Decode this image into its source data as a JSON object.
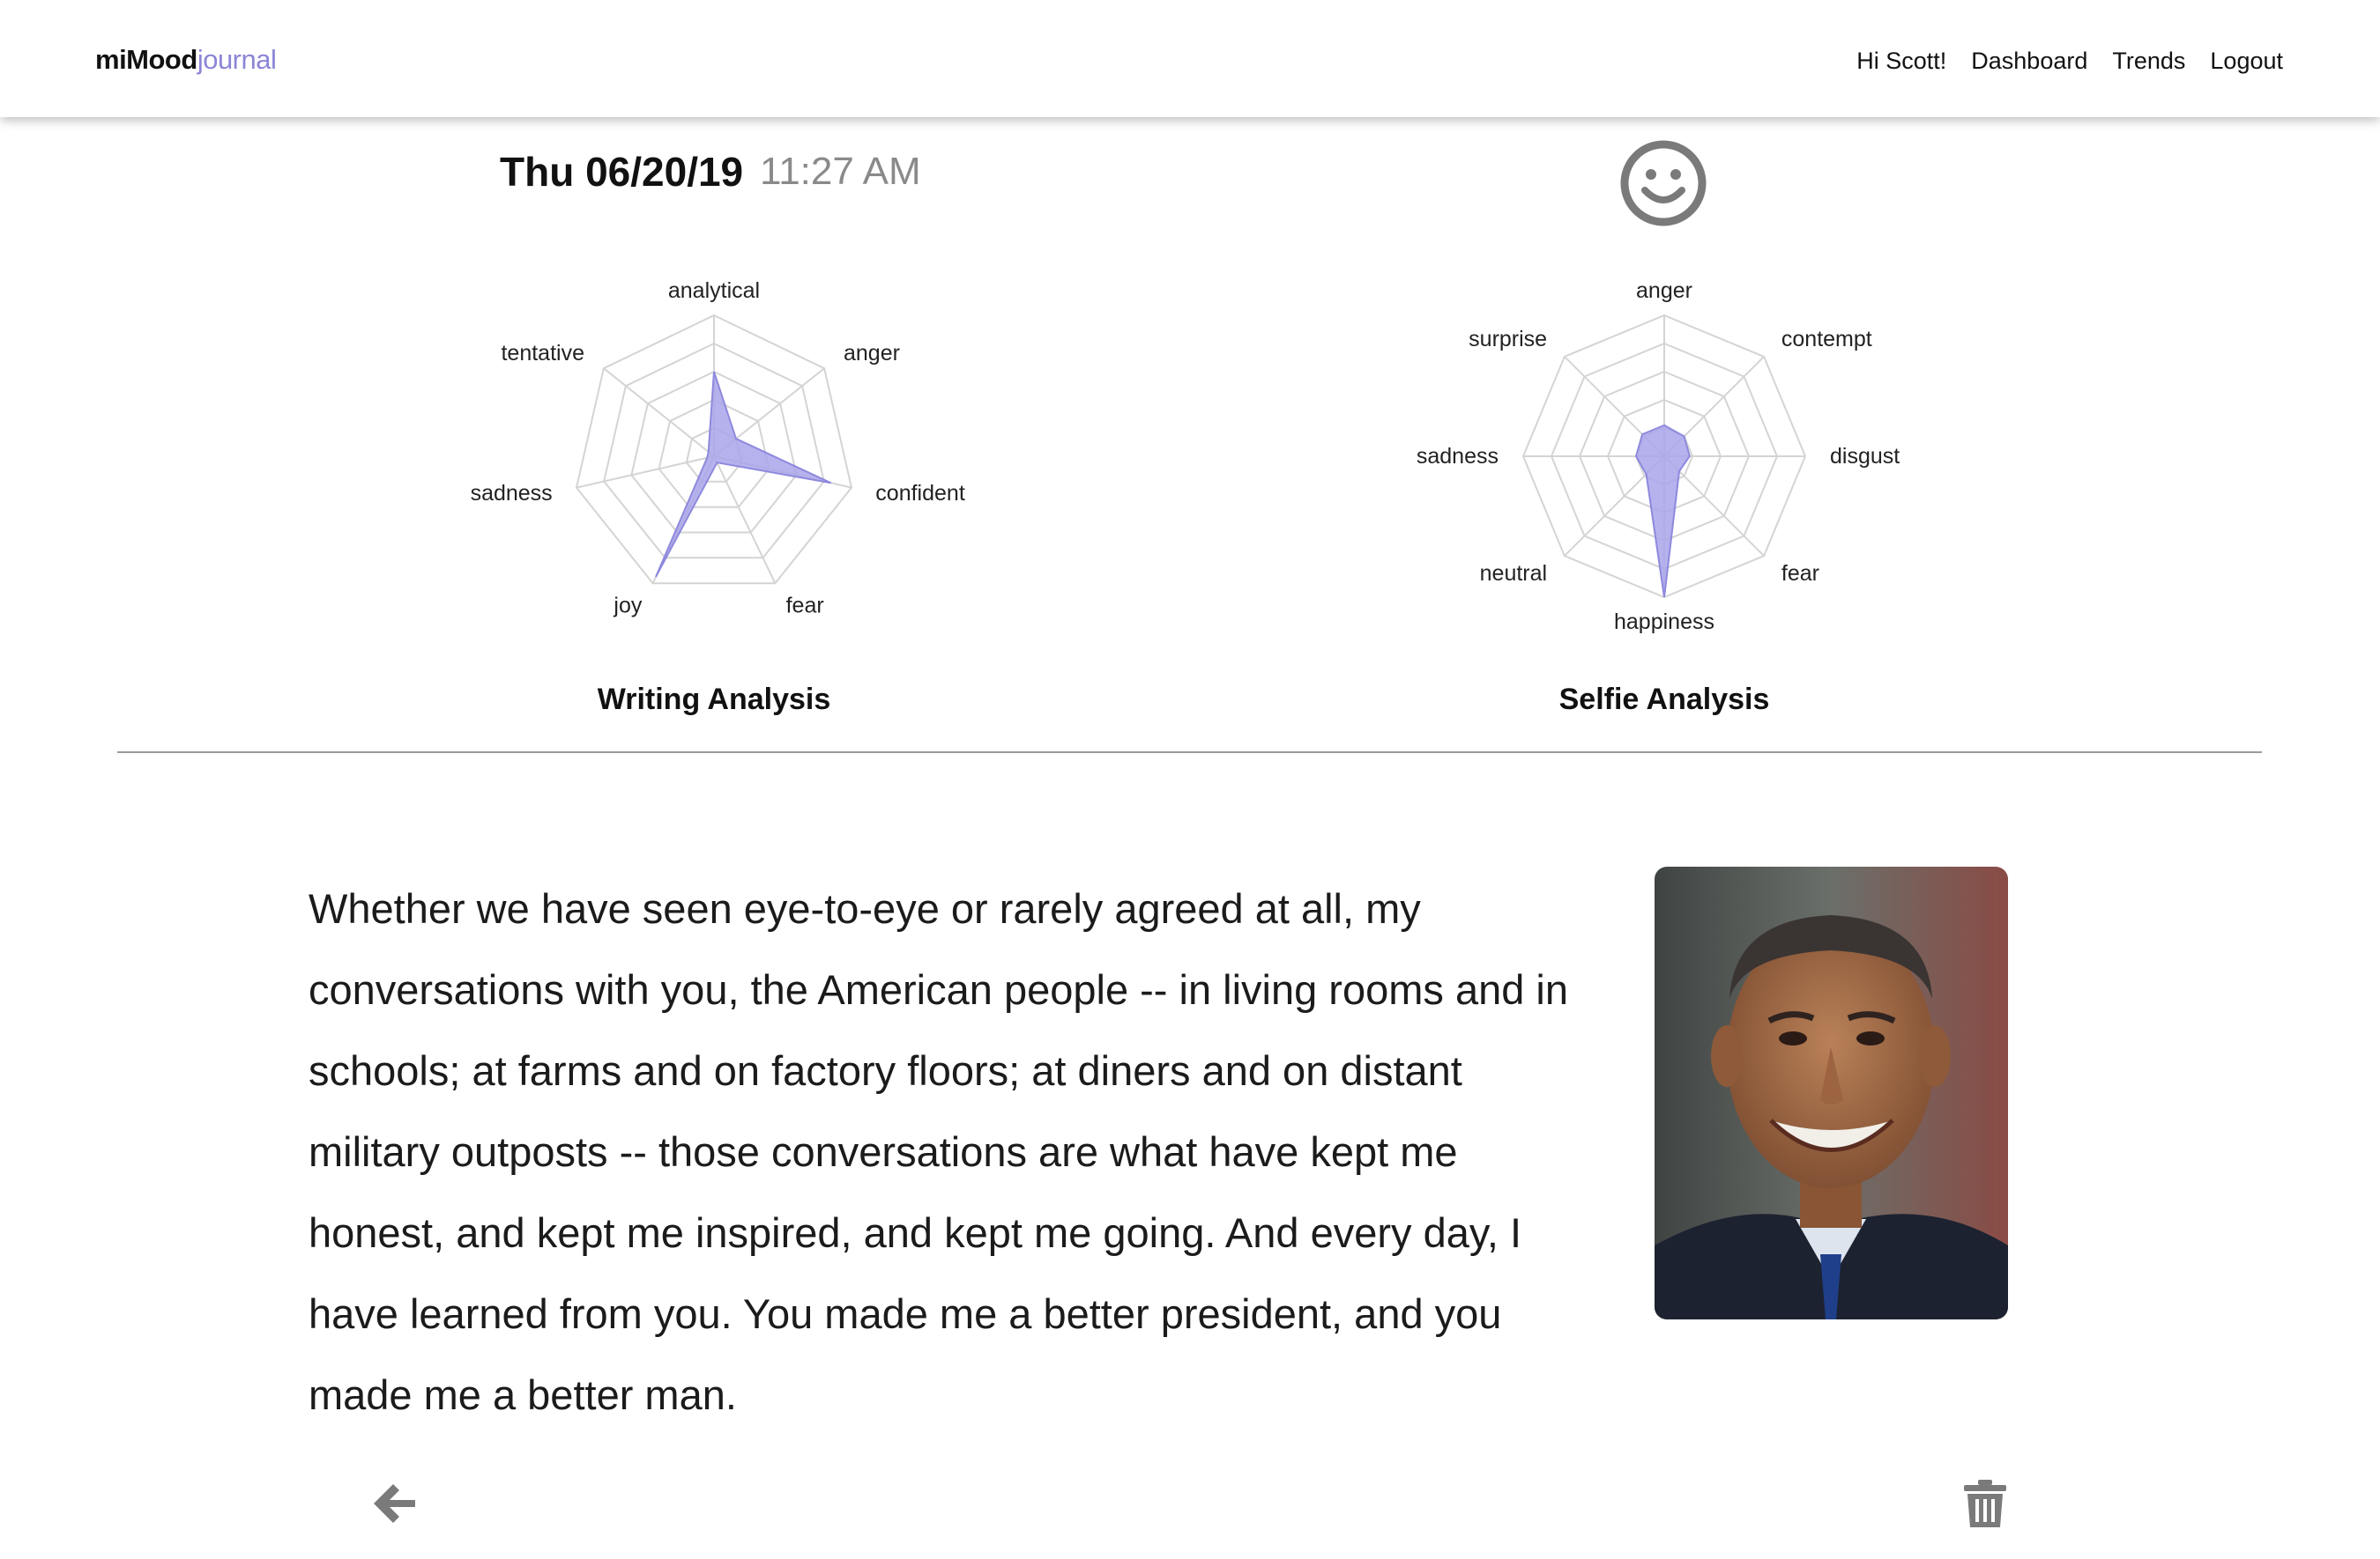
{
  "nav": {
    "brand_mood": "miMood",
    "brand_journal": "journal",
    "greeting": "Hi Scott!",
    "dashboard": "Dashboard",
    "trends": "Trends",
    "logout": "Logout"
  },
  "entry": {
    "date": "Thu 06/20/19",
    "time": "11:27 AM",
    "mood_icon": "smiley-face-icon",
    "text": "Whether we have seen eye-to-eye or rarely agreed at all, my conversations with you, the American people -- in living rooms and in schools; at farms and on factory floors; at diners and on distant military outposts -- those conversations are what have kept me honest, and kept me inspired, and kept me going. And every day, I have learned from you. You made me a better president, and you made me a better man."
  },
  "icons": {
    "back": "arrow-left-icon",
    "delete": "trash-icon"
  },
  "colors": {
    "accent": "#8b86d6",
    "radar_fill": "#a9a5ea",
    "radar_stroke": "#8d89dd",
    "grid": "#d4d4d4"
  },
  "chart_data": [
    {
      "type": "radar",
      "title": "Writing Analysis",
      "axes": [
        "analytical",
        "anger",
        "confident",
        "fear",
        "joy",
        "sadness",
        "tentative"
      ],
      "values": [
        0.6,
        0.2,
        0.85,
        0.05,
        0.95,
        0.05,
        0.05
      ],
      "rmax": 1,
      "rings": 5
    },
    {
      "type": "radar",
      "title": "Selfie Analysis",
      "axes": [
        "anger",
        "contempt",
        "disgust",
        "fear",
        "happiness",
        "neutral",
        "sadness",
        "surprise"
      ],
      "values": [
        0.22,
        0.2,
        0.18,
        0.15,
        1.0,
        0.18,
        0.2,
        0.22
      ],
      "rmax": 1,
      "rings": 5
    }
  ]
}
